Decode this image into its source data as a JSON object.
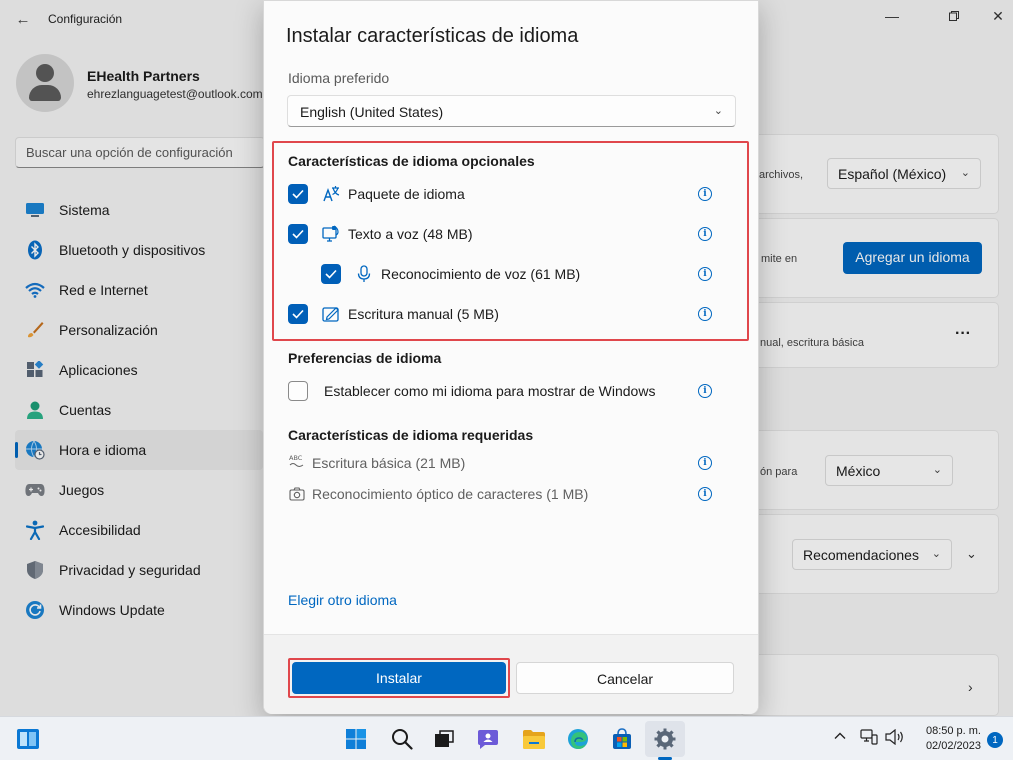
{
  "settings": {
    "app_title": "Configuración",
    "profile": {
      "name": "EHealth Partners",
      "email": "ehrezlanguagetest@outlook.com"
    },
    "search_placeholder": "Buscar una opción de configuración",
    "nav": [
      {
        "label": "Sistema",
        "icon": "monitor-icon",
        "color": "#0a7cc8"
      },
      {
        "label": "Bluetooth y dispositivos",
        "icon": "bluetooth-icon",
        "color": "#0067c0"
      },
      {
        "label": "Red e Internet",
        "icon": "wifi-icon",
        "color": "#0067c0"
      },
      {
        "label": "Personalización",
        "icon": "brush-icon",
        "color": "#c7721e"
      },
      {
        "label": "Aplicaciones",
        "icon": "apps-icon",
        "color": "#4a5a6e"
      },
      {
        "label": "Cuentas",
        "icon": "person-icon",
        "color": "#1b9e77"
      },
      {
        "label": "Hora e idioma",
        "icon": "globe-clock-icon",
        "color": "#0a7cc8",
        "active": true
      },
      {
        "label": "Juegos",
        "icon": "gamepad-icon",
        "color": "#6b6b6b"
      },
      {
        "label": "Accesibilidad",
        "icon": "accessibility-icon",
        "color": "#0b73c7"
      },
      {
        "label": "Privacidad y seguridad",
        "icon": "shield-icon",
        "color": "#5d6673"
      },
      {
        "label": "Windows Update",
        "icon": "update-icon",
        "color": "#0a7cc8"
      }
    ],
    "right": {
      "archivos_text": "archivos,",
      "lang_dropdown": "Español (México)",
      "limite_text": "mite en",
      "add_language_button": "Agregar un idioma",
      "more_button": "···",
      "escritura_text": "nual, escritura básica",
      "pais_text": "ón para",
      "region_dropdown": "México",
      "recomendaciones_dropdown": "Recomendaciones"
    }
  },
  "dialog": {
    "title": "Instalar características de idioma",
    "preferred_label": "Idioma preferido",
    "preferred_value": "English (United States)",
    "optional_heading": "Características de idioma opcionales",
    "optional": [
      {
        "label": "Paquete de idioma",
        "icon": "language-pack-icon",
        "checked": true
      },
      {
        "label": "Texto a voz (48 MB)",
        "icon": "text-to-speech-icon",
        "checked": true
      },
      {
        "label": "Reconocimiento de voz (61 MB)",
        "icon": "microphone-icon",
        "checked": true
      },
      {
        "label": "Escritura manual (5 MB)",
        "icon": "handwriting-icon",
        "checked": true
      }
    ],
    "preferences_heading": "Preferencias de idioma",
    "display_language_label": "Establecer como mi idioma para mostrar de Windows",
    "display_language_checked": false,
    "required_heading": "Características de idioma requeridas",
    "required": [
      {
        "label": "Escritura básica (21 MB)",
        "icon": "abc-icon"
      },
      {
        "label": "Reconocimiento óptico de caracteres (1 MB)",
        "icon": "camera-icon"
      }
    ],
    "choose_other": "Elegir otro idioma",
    "install_button": "Instalar",
    "cancel_button": "Cancelar",
    "highlight_color": "#e0474c",
    "accent_color": "#0067c0"
  },
  "taskbar": {
    "time": "08:50 p. m.",
    "date": "02/02/2023",
    "notification_count": "1",
    "apps": [
      "widgets-icon",
      "start-icon",
      "search-icon",
      "task-view-icon",
      "chat-icon",
      "file-explorer-icon",
      "edge-icon",
      "store-icon",
      "settings-icon"
    ],
    "tray": [
      "chevron-up-icon",
      "network-icon",
      "volume-icon"
    ]
  }
}
